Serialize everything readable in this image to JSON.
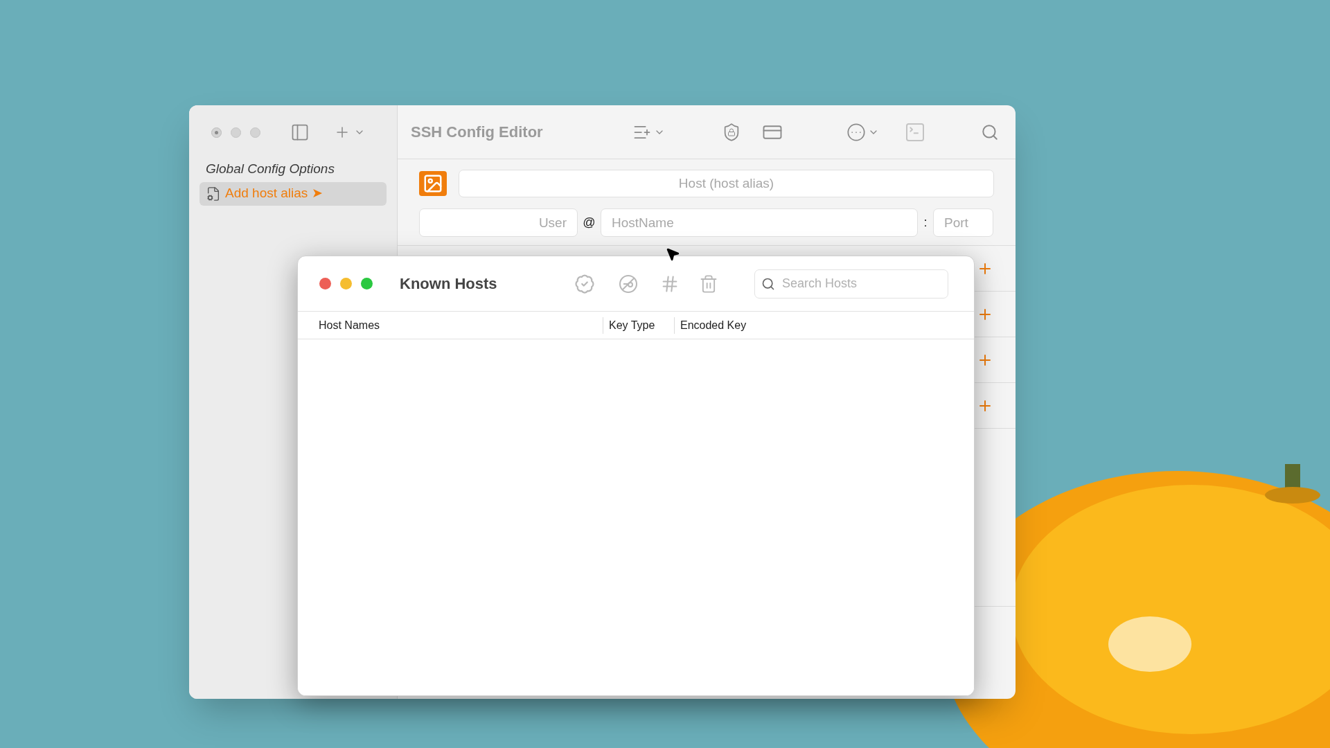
{
  "main_window": {
    "title": "SSH Config Editor",
    "sidebar": {
      "section_title": "Global Config Options",
      "items": [
        {
          "label": "Add host alias ➤",
          "selected": true
        }
      ]
    },
    "form": {
      "host_placeholder": "Host (host alias)",
      "user_placeholder": "User",
      "at_sign": "@",
      "hostname_placeholder": "HostName",
      "colon": ":",
      "port_placeholder": "Port"
    }
  },
  "known_hosts_window": {
    "title": "Known Hosts",
    "search": {
      "placeholder": "Search Hosts"
    },
    "columns": [
      {
        "label": "Host Names"
      },
      {
        "label": "Key Type"
      },
      {
        "label": "Encoded Key"
      }
    ]
  }
}
